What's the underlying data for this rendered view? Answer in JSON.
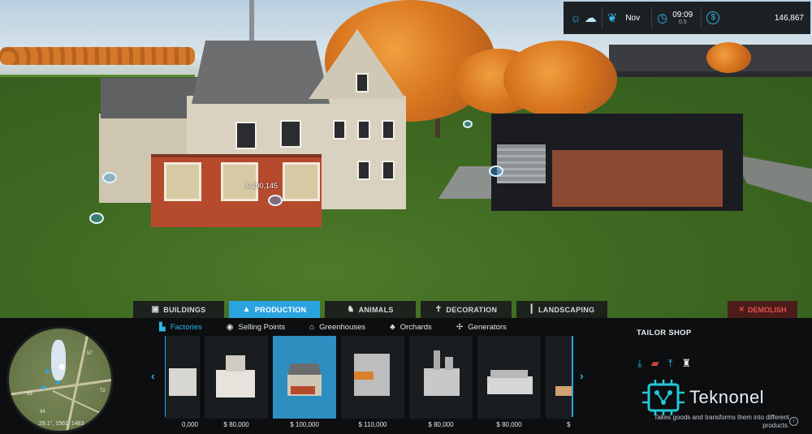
{
  "scene": {
    "price_tag": "$ 100,145"
  },
  "hud": {
    "weather_icon": "sun-icon",
    "cloud_icon": "cloud-icon",
    "season_icon": "plant-icon",
    "month": "Nov",
    "clock_icon": "clock-icon",
    "time": "09:09",
    "time_scale": "0.5",
    "money_icon": "dollar-coin-icon",
    "money": "146,867"
  },
  "tabs": [
    {
      "label": "BUILDINGS",
      "icon": "tractor-icon",
      "active": false
    },
    {
      "label": "PRODUCTION",
      "icon": "factory-icon",
      "active": true
    },
    {
      "label": "ANIMALS",
      "icon": "cow-icon",
      "active": false
    },
    {
      "label": "DECORATION",
      "icon": "figure-icon",
      "active": false
    },
    {
      "label": "LANDSCAPING",
      "icon": "shovel-icon",
      "active": false
    }
  ],
  "demolish": {
    "label": "DEMOLISH",
    "icon": "close-icon"
  },
  "subcategories": [
    {
      "label": "Factories",
      "icon": "factory-icon",
      "active": true
    },
    {
      "label": "Selling Points",
      "icon": "dollar-icon",
      "active": false
    },
    {
      "label": "Greenhouses",
      "icon": "greenhouse-icon",
      "active": false
    },
    {
      "label": "Orchards",
      "icon": "orchard-icon",
      "active": false
    },
    {
      "label": "Generators",
      "icon": "wind-turbine-icon",
      "active": false
    }
  ],
  "minimap": {
    "labels": [
      "57",
      "72",
      "93",
      "94"
    ],
    "coordinates": "29.1°, 1561, 1483"
  },
  "items": [
    {
      "price": "0,000",
      "selected": false
    },
    {
      "price": "$ 80,000",
      "selected": false
    },
    {
      "price": "$ 100,000",
      "selected": true
    },
    {
      "price": "$ 110,000",
      "selected": false
    },
    {
      "price": "$ 80,000",
      "selected": false
    },
    {
      "price": "$ 80,000",
      "selected": false
    },
    {
      "price": "$",
      "selected": false
    }
  ],
  "info": {
    "title": "TAILOR SHOP",
    "icons": [
      "download-icon",
      "fabric-icon",
      "upload-icon",
      "clothing-icon"
    ],
    "description": "Takes goods and transforms them into different products.",
    "help": "i"
  },
  "watermark": {
    "text": "Teknonel"
  },
  "colors": {
    "accent": "#2aa4df",
    "demolish": "#e0514a"
  }
}
